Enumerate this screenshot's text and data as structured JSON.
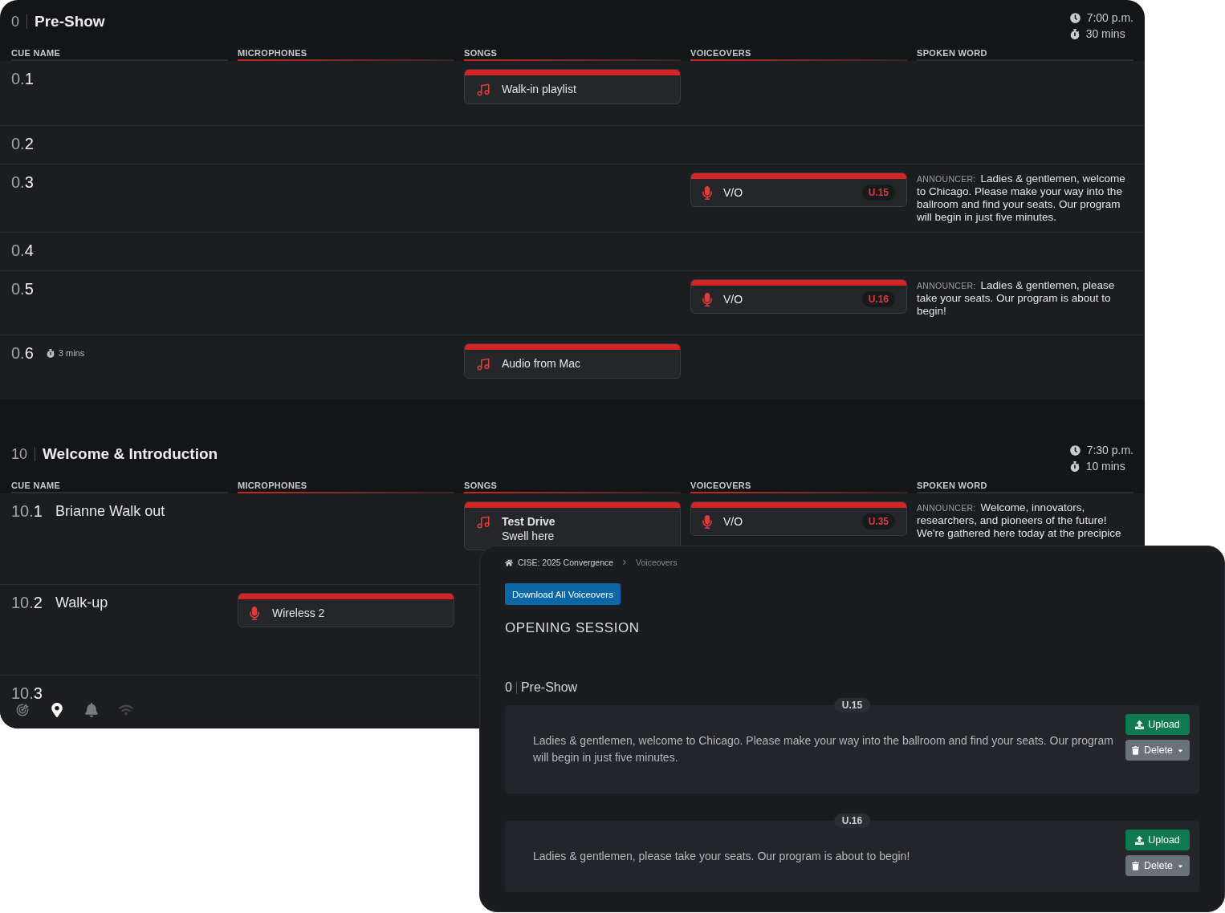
{
  "cue_window": {
    "sections": [
      {
        "number": "0",
        "title": "Pre-Show",
        "start_time": "7:00 p.m.",
        "duration": "30 mins",
        "columns": [
          {
            "label": "CUE NAME",
            "kind": "text"
          },
          {
            "label": "MICROPHONES",
            "kind": "media"
          },
          {
            "label": "SONGS",
            "kind": "media"
          },
          {
            "label": "VOICEOVERS",
            "kind": "media"
          },
          {
            "label": "SPOKEN WORD",
            "kind": "text"
          }
        ],
        "cues": [
          {
            "number": "0.**1**",
            "song": {
              "title": "Walk-in playlist"
            }
          },
          {
            "number": "0.**2**"
          },
          {
            "number": "0.**3**",
            "voiceover": {
              "label": "V/O",
              "code": "U.15"
            },
            "spoken_word": {
              "speaker": "ANNOUNCER:",
              "text": "Ladies & gentlemen, welcome to Chicago. Please make your way into the ballroom and find your seats. Our program will begin in just five minutes."
            }
          },
          {
            "number": "0.**4**"
          },
          {
            "number": "0.**5**",
            "voiceover": {
              "label": "V/O",
              "code": "U.16"
            },
            "spoken_word": {
              "speaker": "ANNOUNCER:",
              "text": "Ladies & gentlemen, please take your seats. Our program is about to begin!"
            }
          },
          {
            "number": "0.**6**",
            "duration": "3 mins",
            "song": {
              "title": "Audio from Mac"
            }
          }
        ]
      },
      {
        "number": "10",
        "title": "Welcome & Introduction",
        "start_time": "7:30 p.m.",
        "duration": "10 mins",
        "columns": [
          {
            "label": "CUE NAME",
            "kind": "text"
          },
          {
            "label": "MICROPHONES",
            "kind": "media"
          },
          {
            "label": "SONGS",
            "kind": "media"
          },
          {
            "label": "VOICEOVERS",
            "kind": "media"
          },
          {
            "label": "SPOKEN WORD",
            "kind": "text"
          }
        ],
        "cues": [
          {
            "number": "10.**1**",
            "name": "Brianne Walk out",
            "song": {
              "title": "Test Drive",
              "note": "Swell here"
            },
            "voiceover": {
              "label": "V/O",
              "code": "U.35"
            },
            "spoken_word": {
              "speaker": "ANNOUNCER:",
              "text": "Welcome, innovators, researchers, and pioneers of the future! We're gathered here today at the precipice"
            }
          },
          {
            "number": "10.**2**",
            "name": "Walk-up",
            "microphone": {
              "label": "Wireless 2"
            }
          },
          {
            "number": "10.**3**"
          }
        ]
      }
    ],
    "toolbar": [
      {
        "kind": "target",
        "selected": false,
        "disabled": false
      },
      {
        "kind": "pin",
        "selected": true,
        "disabled": false
      },
      {
        "kind": "bell",
        "selected": false,
        "disabled": false
      },
      {
        "kind": "wifi",
        "selected": false,
        "disabled": true
      }
    ]
  },
  "voiceover_window": {
    "breadcrumb": [
      {
        "label": "CISE: 2025 Convergence",
        "selected": false
      },
      {
        "label": "Voiceovers",
        "selected": true
      }
    ],
    "download_button": "Download All Voiceovers",
    "session_title": "OPENING SESSION",
    "segments": [
      {
        "number": "0",
        "title": "Pre-Show",
        "voiceovers": [
          {
            "code": "U.15",
            "text": "Ladies & gentlemen, welcome to Chicago. Please make your way into the ballroom and find your seats. Our program will begin in just five minutes.",
            "actions": [
              {
                "kind": "upload",
                "label": "Upload"
              },
              {
                "kind": "delete",
                "label": "Delete"
              }
            ]
          },
          {
            "code": "U.16",
            "text": "Ladies & gentlemen, please take your seats. Our program is about to begin!",
            "actions": [
              {
                "kind": "upload",
                "label": "Upload"
              },
              {
                "kind": "delete",
                "label": "Delete"
              }
            ]
          }
        ]
      }
    ]
  }
}
